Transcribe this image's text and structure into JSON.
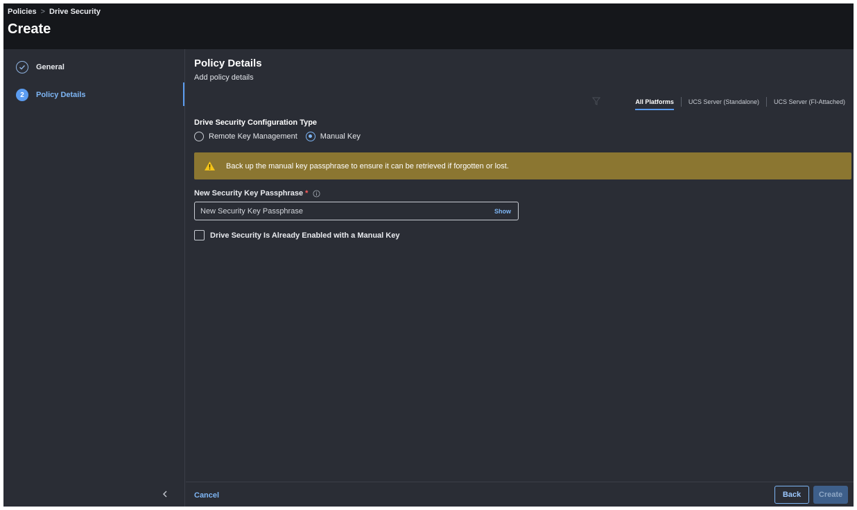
{
  "breadcrumb": {
    "root": "Policies",
    "current": "Drive Security"
  },
  "page_title": "Create",
  "stepper": {
    "steps": [
      {
        "label": "General",
        "status": "completed"
      },
      {
        "label": "Policy Details",
        "number": "2",
        "status": "current"
      }
    ]
  },
  "section": {
    "title": "Policy Details",
    "subtitle": "Add policy details"
  },
  "platform_tabs": {
    "items": [
      "All Platforms",
      "UCS Server (Standalone)",
      "UCS Server (FI-Attached)"
    ],
    "selected": "All Platforms"
  },
  "config_type": {
    "label": "Drive Security Configuration Type",
    "options": [
      "Remote Key Management",
      "Manual Key"
    ],
    "selected": "Manual Key"
  },
  "warning": {
    "text": "Back up the manual key passphrase to ensure it can be retrieved if forgotten or lost."
  },
  "passphrase": {
    "label": "New Security Key Passphrase",
    "required_mark": "*",
    "placeholder": "New Security Key Passphrase",
    "value": "",
    "show_label": "Show"
  },
  "already_enabled": {
    "label": "Drive Security Is Already Enabled with a Manual Key",
    "checked": false
  },
  "footer": {
    "cancel_label": "Cancel",
    "back_label": "Back",
    "create_label": "Create"
  },
  "colors": {
    "accent": "#5b9cf0",
    "warning": "#8b7631",
    "panel": "#2a2d35",
    "header": "#15171b"
  }
}
